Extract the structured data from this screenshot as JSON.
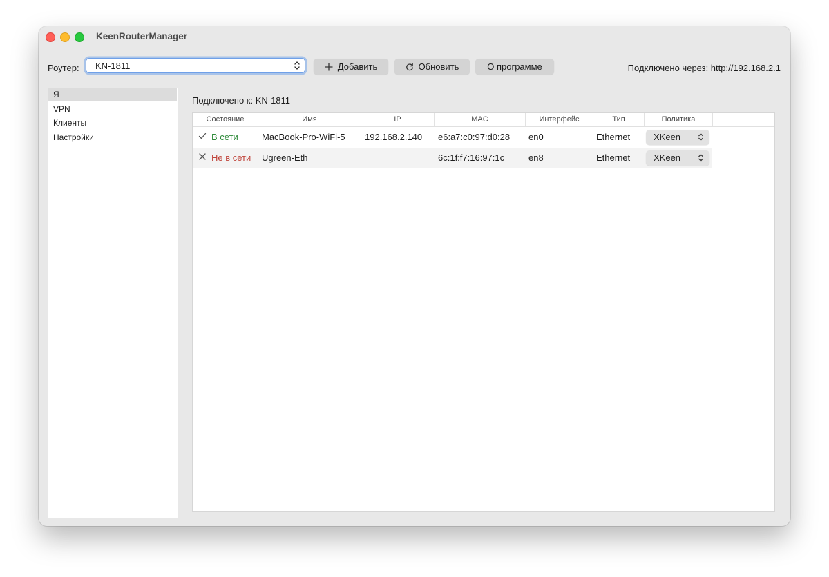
{
  "window": {
    "title": "KeenRouterManager"
  },
  "toolbar": {
    "router_label": "Роутер:",
    "router_value": "KN-1811",
    "add_label": "Добавить",
    "refresh_label": "Обновить",
    "about_label": "О программе",
    "connected_via": "Подключено через: http://192.168.2.1"
  },
  "sidebar": {
    "items": [
      {
        "label": "Я",
        "selected": true
      },
      {
        "label": "VPN",
        "selected": false
      },
      {
        "label": "Клиенты",
        "selected": false
      },
      {
        "label": "Настройки",
        "selected": false
      }
    ]
  },
  "main": {
    "connected_to": "Подключено к: KN-1811",
    "table": {
      "columns": [
        "Состояние",
        "Имя",
        "IP",
        "MAC",
        "Интерфейс",
        "Тип",
        "Политика"
      ],
      "rows": [
        {
          "status": "В сети",
          "status_icon": "check-icon",
          "name": "MacBook-Pro-WiFi-5",
          "ip": "192.168.2.140",
          "mac": "e6:a7:c0:97:d0:28",
          "interface": "en0",
          "type": "Ethernet",
          "policy": "XKeen"
        },
        {
          "status": "Не в сети",
          "status_icon": "x-icon",
          "name": "Ugreen-Eth",
          "ip": "",
          "mac": "6c:1f:f7:16:97:1c",
          "interface": "en8",
          "type": "Ethernet",
          "policy": "XKeen"
        }
      ]
    }
  },
  "colors": {
    "online": "#2e8a3a",
    "offline": "#c0453c",
    "accent": "#6fa0e8"
  }
}
